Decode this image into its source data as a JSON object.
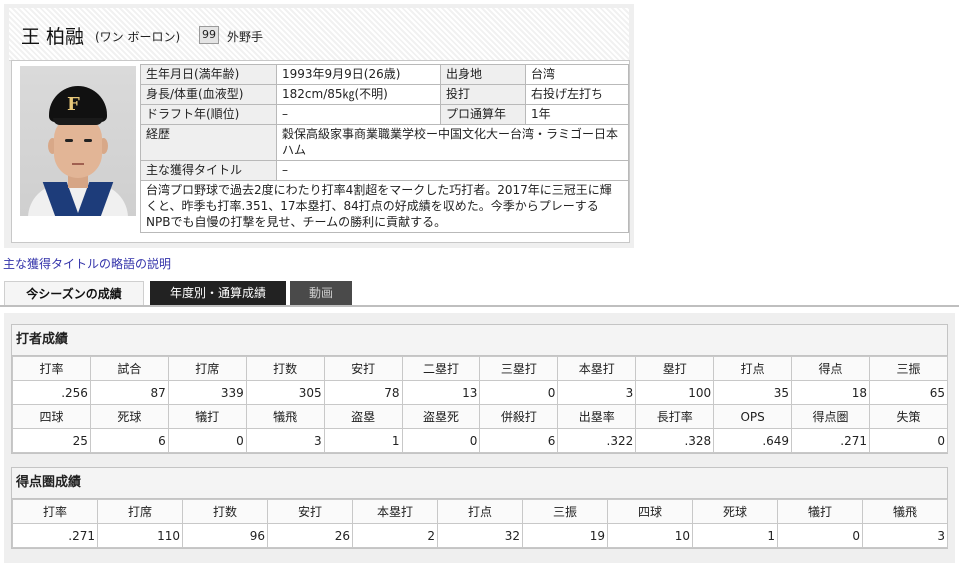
{
  "player": {
    "name": "王 柏融",
    "kana": "(ワン ボーロン)",
    "number": "99",
    "position": "外野手"
  },
  "info": {
    "birth_label": "生年月日(満年齢)",
    "birth_value": "1993年9月9日(26歳)",
    "hometown_label": "出身地",
    "hometown_value": "台湾",
    "body_label": "身長/体重(血液型)",
    "body_value": "182cm/85㎏(不明)",
    "throw_label": "投打",
    "throw_value": "右投げ左打ち",
    "draft_label": "ドラフト年(順位)",
    "draft_value": "–",
    "pro_years_label": "プロ通算年",
    "pro_years_value": "1年",
    "career_label": "経歴",
    "career_value": "穀保高級家事商業職業学校ー中国文化大ー台湾・ラミゴー日本ハム",
    "titles_label": "主な獲得タイトル",
    "titles_value": "–",
    "description": "台湾プロ野球で過去2度にわたり打率4割超をマークした巧打者。2017年に三冠王に輝くと、昨季も打率.351、17本塁打、84打点の好成績を収めた。今季からプレーするNPBでも自慢の打撃を見せ、チームの勝利に貢献する。"
  },
  "link_text": "主な獲得タイトルの略語の説明",
  "tabs": [
    "今シーズンの成績",
    "年度別・通算成績",
    "動画"
  ],
  "batting": {
    "title": "打者成績",
    "headers1": [
      "打率",
      "試合",
      "打席",
      "打数",
      "安打",
      "二塁打",
      "三塁打",
      "本塁打",
      "塁打",
      "打点",
      "得点",
      "三振"
    ],
    "values1": [
      ".256",
      "87",
      "339",
      "305",
      "78",
      "13",
      "0",
      "3",
      "100",
      "35",
      "18",
      "65"
    ],
    "headers2": [
      "四球",
      "死球",
      "犠打",
      "犠飛",
      "盗塁",
      "盗塁死",
      "併殺打",
      "出塁率",
      "長打率",
      "OPS",
      "得点圏",
      "失策"
    ],
    "values2": [
      "25",
      "6",
      "0",
      "3",
      "1",
      "0",
      "6",
      ".322",
      ".328",
      ".649",
      ".271",
      "0"
    ]
  },
  "risp": {
    "title": "得点圏成績",
    "headers": [
      "打率",
      "打席",
      "打数",
      "安打",
      "本塁打",
      "打点",
      "三振",
      "四球",
      "死球",
      "犠打",
      "犠飛"
    ],
    "values": [
      ".271",
      "110",
      "96",
      "26",
      "2",
      "32",
      "19",
      "10",
      "1",
      "0",
      "3"
    ]
  },
  "colors": {
    "tab_dark": "#222222",
    "link": "#3333aa",
    "uniform_navy": "#1d3c7a"
  }
}
